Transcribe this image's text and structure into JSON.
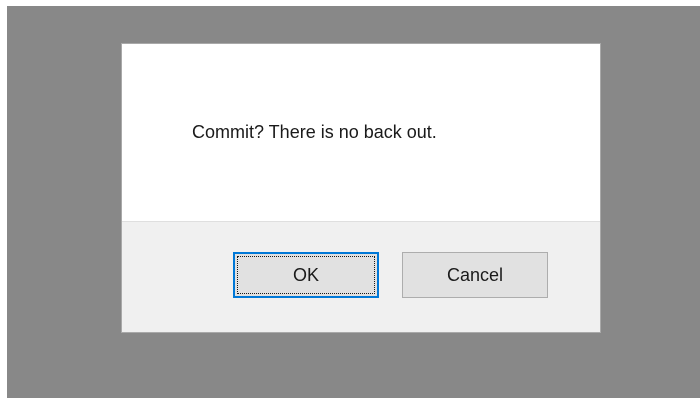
{
  "dialog": {
    "message": "Commit?  There is no back out.",
    "buttons": {
      "ok_label": "OK",
      "cancel_label": "Cancel"
    }
  },
  "colors": {
    "backdrop": "#888888",
    "dialog_background": "#ffffff",
    "button_area_background": "#f0f0f0",
    "button_face": "#e1e1e1",
    "focus_border": "#0078d7"
  }
}
